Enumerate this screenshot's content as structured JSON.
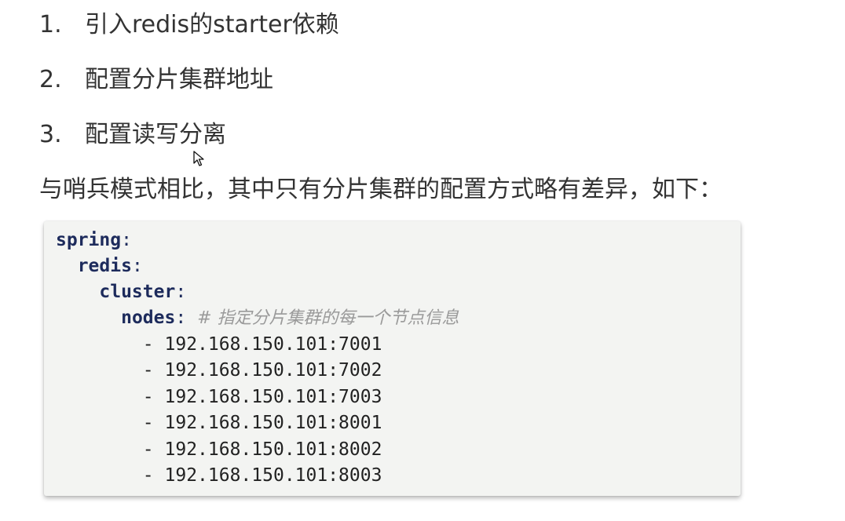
{
  "steps": [
    {
      "number": "1.",
      "text": "引入redis的starter依赖"
    },
    {
      "number": "2.",
      "text": "配置分片集群地址"
    },
    {
      "number": "3.",
      "text": "配置读写分离"
    }
  ],
  "intro": "与哨兵模式相比，其中只有分片集群的配置方式略有差异，如下：",
  "code": {
    "spring_key": "spring",
    "redis_key": "redis",
    "cluster_key": "cluster",
    "nodes_key": "nodes",
    "colon": ":",
    "nodes_comment": "# 指定分片集群的每一个节点信息",
    "dash": "-",
    "nodes": [
      "192.168.150.101:7001",
      "192.168.150.101:7002",
      "192.168.150.101:7003",
      "192.168.150.101:8001",
      "192.168.150.101:8002",
      "192.168.150.101:8003"
    ]
  },
  "colors": {
    "key": "#1d2b5c",
    "comment": "#9a9a9a",
    "code_bg": "#f3f4f2",
    "text": "#333333"
  },
  "icons": {
    "cursor": "mouse-pointer-icon"
  }
}
